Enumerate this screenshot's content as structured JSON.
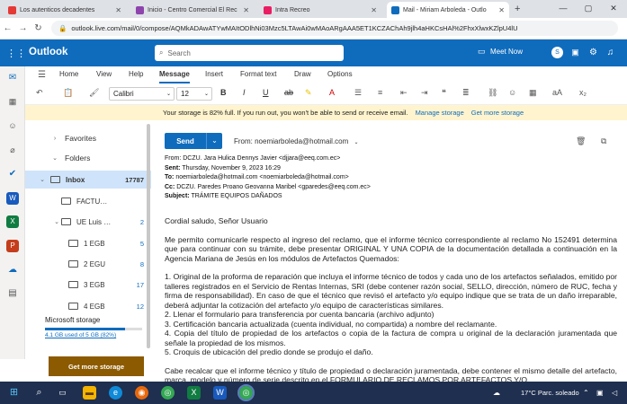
{
  "browser": {
    "tabs": [
      {
        "label": "Los autenticos decadentes",
        "active": false,
        "color": "#e53935"
      },
      {
        "label": "Inicio - Centro Comercial El Rec",
        "active": false,
        "color": "#8e44ad"
      },
      {
        "label": "Intra Recreo",
        "active": false,
        "color": "#e91e63"
      },
      {
        "label": "Mail - Miriam Arboleda - Outlo",
        "active": true,
        "color": "#0f6cbd"
      }
    ],
    "url": "outlook.live.com/mail/0/compose/AQMkADAwATYwMAItODlhNi03Mzc5LTAwAi0wMAoARgAAA5ET1KCZAChAh9jlh4aHKCsHAl%2FhxXlwxKZlpU4lU"
  },
  "outlook": {
    "brand": "Outlook",
    "search_placeholder": "Search",
    "meet_now": "Meet Now",
    "ribbon_tabs": [
      "Home",
      "View",
      "Help",
      "Message",
      "Insert",
      "Format text",
      "Draw",
      "Options"
    ],
    "font_name": "Calibri",
    "font_size": "12",
    "banner_text": "Your storage is 82% full. If you run out, you won't be able to send or receive email.",
    "banner_link1": "Manage storage",
    "banner_link2": "Get more storage"
  },
  "folders": [
    {
      "label": "Favorites",
      "count": "",
      "level": 0,
      "chevron": "›"
    },
    {
      "label": "Folders",
      "count": "",
      "level": 0,
      "chevron": "⌄"
    },
    {
      "label": "Inbox",
      "count": "17787",
      "level": 1,
      "chevron": "⌄",
      "selected": true
    },
    {
      "label": "FACTU…",
      "count": "",
      "level": 2,
      "chevron": ""
    },
    {
      "label": "UE Luis …",
      "count": "2",
      "level": 2,
      "chevron": "⌄"
    },
    {
      "label": "1 EGB",
      "count": "5",
      "level": 3,
      "chevron": ""
    },
    {
      "label": "2 EGU",
      "count": "8",
      "level": 3,
      "chevron": ""
    },
    {
      "label": "3 EGB",
      "count": "17",
      "level": 3,
      "chevron": ""
    },
    {
      "label": "4 EGB",
      "count": "12",
      "level": 3,
      "chevron": ""
    }
  ],
  "storage": {
    "title": "Microsoft storage",
    "used": "4.1 GB used of 5 GB (82%)",
    "used_fraction": 0.82,
    "button": "Get more storage"
  },
  "compose": {
    "send": "Send",
    "from": "From: noemiarboleda@hotmail.com",
    "quoted": {
      "from": "From: DCZU. Jara Hulica Dennys Javier <djjara@eeq.com.ec>",
      "sent_label": "Sent:",
      "sent": " Thursday, November 9, 2023 16:29",
      "to_label": "To:",
      "to": " noemiarboleda@hotmail.com <noemiarboleda@hotmail.com>",
      "cc_label": "Cc:",
      "cc": " DCZU. Paredes Proano Geovanna Maribel <gparedes@eeq.com.ec>",
      "subject_label": "Subject:",
      "subject": " TRÁMITE EQUIPOS DAÑADOS"
    },
    "greeting": "Cordial saludo, Señor Usuario",
    "para1": "Me permito comunicarle respecto al ingreso del reclamo, que el informe técnico correspondiente al reclamo No 152491 determina que para continuar con su trámite, debe presentar ORIGINAL Y UNA COPIA de la documentación detallada a continuación en la Agencia Mariana de Jesús en los módulos de Artefactos Quemados:",
    "items": [
      "1. Original de la proforma de reparación que incluya el informe técnico de todos y cada uno de los artefactos señalados, emitido por talleres registrados en el Servicio de Rentas Internas, SRI (debe contener razón social, SELLO, dirección, número de RUC, fecha y firma de responsabilidad). En caso de que el técnico que revisó el artefacto y/o equipo indique que se trata de un daño irreparable, deberá adjuntar la cotización del artefacto y/o equipo de características similares.",
      "2. Llenar el formulario para transferencia por cuenta bancaria (archivo adjunto)",
      "3. Certificación bancaria actualizada (cuenta individual, no compartida) a nombre del reclamante.",
      "4. Copia del título de propiedad de los artefactos o copia de la factura de compra u original de la declaración juramentada que señale la propiedad de los mismos.",
      "5. Croquis de ubicación del predio donde se produjo el daño."
    ],
    "para2": "Cabe recalcar que el informe técnico y título de propiedad o declaración juramentada, debe contener el mismo detalle del artefacto, marca, modelo y número de serie descrito en el FORMULARIO DE RECLAMOS POR ARTEFACTOS Y/O"
  },
  "taskbar": {
    "weather": "17°C  Parc. soleado"
  }
}
